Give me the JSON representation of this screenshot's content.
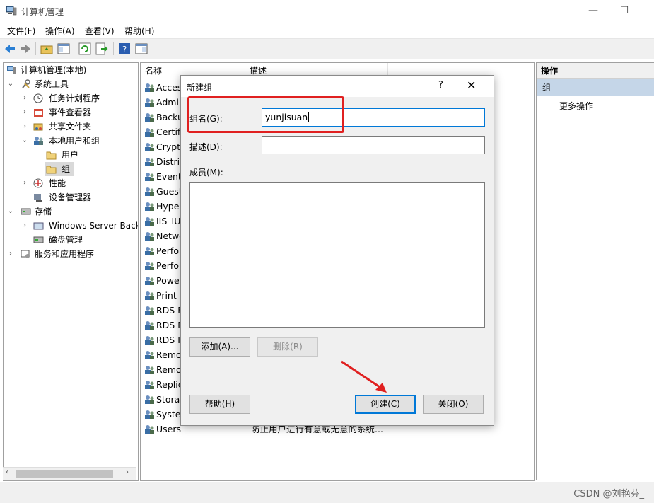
{
  "window": {
    "title": "计算机管理",
    "controls": {
      "minimize": "—",
      "maximize": "☐"
    }
  },
  "menu": [
    "文件(F)",
    "操作(A)",
    "查看(V)",
    "帮助(H)"
  ],
  "tree": {
    "root": "计算机管理(本地)",
    "system_tools": "系统工具",
    "task_scheduler": "任务计划程序",
    "event_viewer": "事件查看器",
    "shared_folders": "共享文件夹",
    "local_users_groups": "本地用户和组",
    "users": "用户",
    "groups": "组",
    "performance": "性能",
    "device_manager": "设备管理器",
    "storage": "存储",
    "windows_server_backup": "Windows Server Back",
    "disk_management": "磁盘管理",
    "services_apps": "服务和应用程序"
  },
  "list": {
    "col_name": "名称",
    "col_desc": "描述",
    "rows": [
      "Acces",
      "Admin",
      "Backu",
      "Certifi",
      "Crypto",
      "Distrib",
      "Event",
      "Guest",
      "Hyper",
      "IIS_IU",
      "Netwo",
      "Perfor",
      "Perfor",
      "Power",
      "Print C",
      "RDS E",
      "RDS M",
      "RDS R",
      "Remo",
      "Remo",
      "Replic",
      "Storag",
      "Syster",
      "Users"
    ],
    "last_row_desc": "防止用户进行有意或无意的系统..."
  },
  "actions": {
    "header": "操作",
    "group": "组",
    "more": "更多操作"
  },
  "dialog": {
    "title": "新建组",
    "help_glyph": "?",
    "close_glyph": "✕",
    "group_name_label": "组名(G):",
    "group_name_value": "yunjisuan",
    "description_label": "描述(D):",
    "description_value": "",
    "members_label": "成员(M):",
    "add_button": "添加(A)...",
    "remove_button": "删除(R)",
    "help_button": "帮助(H)",
    "create_button": "创建(C)",
    "close_button": "关闭(O)"
  },
  "status": {
    "watermark": "CSDN @刘艳芬_"
  },
  "colors": {
    "highlight": "#e02020",
    "selection": "#c5d6e8",
    "accent": "#0078d7"
  }
}
